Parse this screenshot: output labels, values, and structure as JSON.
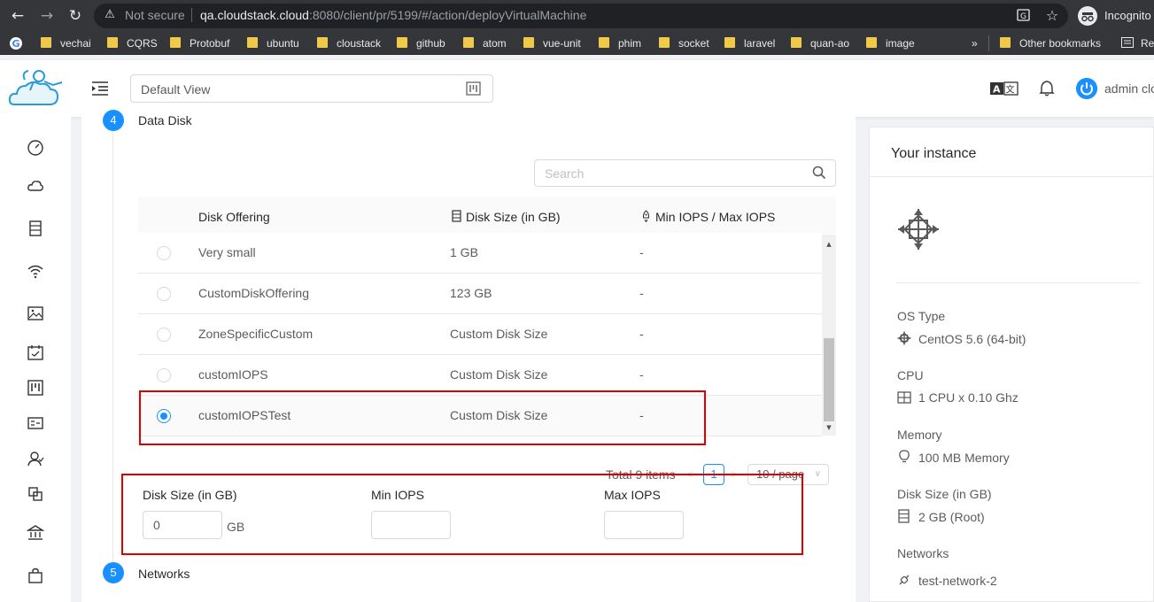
{
  "browser": {
    "security_label": "Not secure",
    "url_host": "qa.cloudstack.cloud",
    "url_rest": ":8080/client/pr/5199/#/action/deployVirtualMachine",
    "profile_label": "Incognito",
    "bookmarks": [
      "vechai",
      "CQRS",
      "Protobuf",
      "ubuntu",
      "cloustack",
      "github",
      "atom",
      "vue-unit",
      "phim",
      "socket",
      "laravel",
      "quan-ao",
      "image"
    ],
    "overflow": "»",
    "other_bookmarks": "Other bookmarks",
    "reading_list": "Re"
  },
  "header": {
    "view_select": "Default View",
    "user_name": "admin clo"
  },
  "steps": {
    "data_disk": {
      "number": "4",
      "title": "Data Disk"
    },
    "networks": {
      "number": "5",
      "title": "Networks"
    }
  },
  "disk_table": {
    "search_placeholder": "Search",
    "columns": [
      "Disk Offering",
      "Disk Size (in GB)",
      "Min IOPS / Max IOPS"
    ],
    "rows": [
      {
        "name": "Very small",
        "size": "1 GB",
        "iops": "-",
        "selected": false
      },
      {
        "name": "CustomDiskOffering",
        "size": "123 GB",
        "iops": "-",
        "selected": false
      },
      {
        "name": "ZoneSpecificCustom",
        "size": "Custom Disk Size",
        "iops": "-",
        "selected": false
      },
      {
        "name": "customIOPS",
        "size": "Custom Disk Size",
        "iops": "-",
        "selected": false
      },
      {
        "name": "customIOPSTest",
        "size": "Custom Disk Size",
        "iops": "-",
        "selected": true
      }
    ],
    "pagination": {
      "total": "Total 9 items",
      "current_page": "1",
      "page_size": "10 / page"
    }
  },
  "disk_form": {
    "disk_size_label": "Disk Size (in GB)",
    "disk_size_value": "0",
    "disk_size_suffix": "GB",
    "min_iops_label": "Min IOPS",
    "min_iops_value": "",
    "max_iops_label": "Max IOPS",
    "max_iops_value": ""
  },
  "instance": {
    "title": "Your instance",
    "os_type_label": "OS Type",
    "os_type_value": "CentOS 5.6 (64-bit)",
    "cpu_label": "CPU",
    "cpu_value": "1 CPU x 0.10 Ghz",
    "memory_label": "Memory",
    "memory_value": "100 MB Memory",
    "disk_label": "Disk Size (in GB)",
    "disk_value": "2 GB (Root)",
    "networks_label": "Networks",
    "networks_value": "test-network-2"
  },
  "colors": {
    "accent": "#1890ff",
    "highlight_box": "#e00000",
    "chrome": "#35363a"
  }
}
